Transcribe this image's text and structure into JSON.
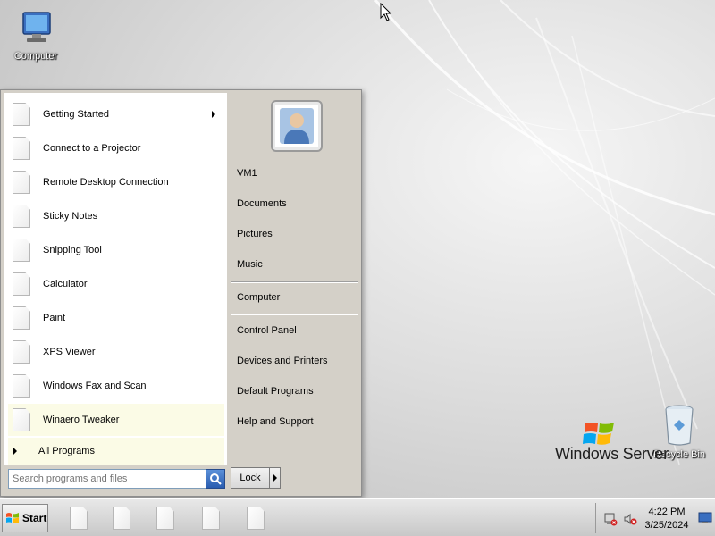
{
  "desktop": {
    "computer_label": "Computer",
    "recycle_bin_label": "Recycle Bin",
    "brand_text": "Windows Server"
  },
  "start_menu": {
    "programs": [
      {
        "label": "Getting Started",
        "has_submenu": true
      },
      {
        "label": "Connect to a Projector"
      },
      {
        "label": "Remote Desktop Connection"
      },
      {
        "label": "Sticky Notes"
      },
      {
        "label": "Snipping Tool"
      },
      {
        "label": "Calculator"
      },
      {
        "label": "Paint"
      },
      {
        "label": "XPS Viewer"
      },
      {
        "label": "Windows Fax and Scan"
      },
      {
        "label": "Winaero Tweaker",
        "highlighted": true
      }
    ],
    "all_programs_label": "All Programs",
    "right_items": {
      "user": "VM1",
      "documents": "Documents",
      "pictures": "Pictures",
      "music": "Music",
      "computer": "Computer",
      "control_panel": "Control Panel",
      "devices_printers": "Devices and Printers",
      "default_programs": "Default Programs",
      "help_support": "Help and Support"
    },
    "search": {
      "placeholder": "Search programs and files",
      "value": ""
    },
    "lock_label": "Lock"
  },
  "taskbar": {
    "start_label": "Start",
    "pinned_count_icons": [
      "document-icon",
      "document-icon",
      "document-icon",
      "document-icon",
      "document-icon"
    ],
    "clock_time": "4:22 PM",
    "clock_date": "3/25/2024"
  },
  "colors": {
    "menu_bg": "#d4d0c8",
    "highlight": "#fbfbe6",
    "search_button": "#2a5db0"
  }
}
